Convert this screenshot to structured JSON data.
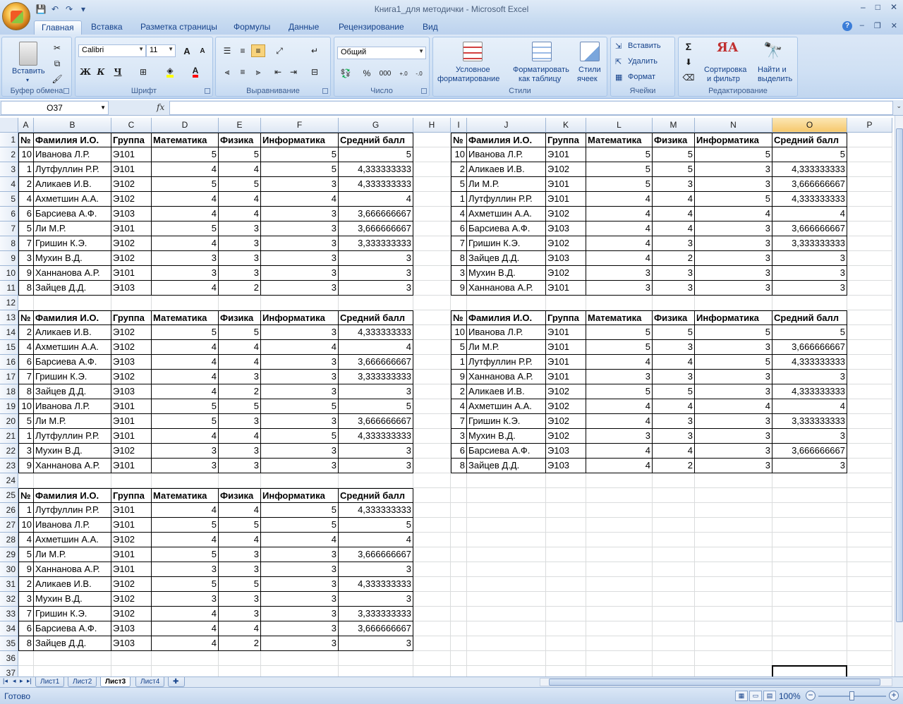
{
  "window": {
    "title": "Книга1_для методички - Microsoft Excel",
    "min": "–",
    "max": "□",
    "close": "✕",
    "wb_min": "–",
    "wb_max": "❐",
    "wb_close": "✕"
  },
  "qat": {
    "save": "💾",
    "undo": "↶",
    "redo": "↷",
    "more": "▾"
  },
  "tabs": [
    "Главная",
    "Вставка",
    "Разметка страницы",
    "Формулы",
    "Данные",
    "Рецензирование",
    "Вид"
  ],
  "active_tab": "Главная",
  "help": "?",
  "ribbon": {
    "clipboard": {
      "label": "Буфер обмена",
      "paste": "Вставить"
    },
    "font": {
      "label": "Шрифт",
      "name": "Calibri",
      "size": "11",
      "bold": "Ж",
      "italic": "К",
      "underline": "Ч",
      "grow": "A",
      "shrink": "A",
      "fill_color": "#ffff00",
      "font_color": "#ff0000"
    },
    "alignment": {
      "label": "Выравнивание"
    },
    "number": {
      "label": "Число",
      "format": "Общий",
      "percent": "%",
      "thousands": "000",
      "inc_dec": ",0 ,00",
      "dec_dec": ",00 ,0"
    },
    "styles": {
      "label": "Стили",
      "cond_format_1": "Условное",
      "cond_format_2": "форматирование",
      "table_1": "Форматировать",
      "table_2": "как таблицу",
      "cell_styles_1": "Стили",
      "cell_styles_2": "ячеек"
    },
    "cells": {
      "label": "Ячейки",
      "insert": "Вставить",
      "delete": "Удалить",
      "format": "Формат"
    },
    "editing": {
      "label": "Редактирование",
      "sum": "Σ",
      "sort_1": "Сортировка",
      "sort_2": "и фильтр",
      "find_1": "Найти и",
      "find_2": "выделить"
    }
  },
  "formula_bar": {
    "name_box": "O37",
    "fx": "fx",
    "formula": ""
  },
  "columns": [
    "A",
    "B",
    "C",
    "D",
    "E",
    "F",
    "G",
    "H",
    "I",
    "J",
    "K",
    "L",
    "M",
    "N",
    "O",
    "P"
  ],
  "selected_column": "O",
  "rows": [
    "1",
    "2",
    "3",
    "4",
    "5",
    "6",
    "7",
    "8",
    "9",
    "10",
    "11",
    "12",
    "13",
    "14",
    "15",
    "16",
    "17",
    "18",
    "19",
    "20",
    "21",
    "22",
    "23",
    "24",
    "25",
    "26",
    "27",
    "28",
    "29",
    "30",
    "31",
    "32",
    "33",
    "34",
    "35",
    "36",
    "37"
  ],
  "headers": [
    "№",
    "Фамилия И.О.",
    "Группа",
    "Математика",
    "Физика",
    "Информатика",
    "Средний балл"
  ],
  "tables": [
    {
      "id": "t1",
      "rows": [
        [
          "10",
          "Иванова Л.Р.",
          "Э101",
          "5",
          "5",
          "5",
          "5"
        ],
        [
          "1",
          "Лутфуллин Р.Р.",
          "Э101",
          "4",
          "4",
          "5",
          "4,333333333"
        ],
        [
          "2",
          "Аликаев И.В.",
          "Э102",
          "5",
          "5",
          "3",
          "4,333333333"
        ],
        [
          "4",
          "Ахметшин А.А.",
          "Э102",
          "4",
          "4",
          "4",
          "4"
        ],
        [
          "6",
          "Барсиева А.Ф.",
          "Э103",
          "4",
          "4",
          "3",
          "3,666666667"
        ],
        [
          "5",
          "Ли М.Р.",
          "Э101",
          "5",
          "3",
          "3",
          "3,666666667"
        ],
        [
          "7",
          "Гришин К.Э.",
          "Э102",
          "4",
          "3",
          "3",
          "3,333333333"
        ],
        [
          "3",
          "Мухин В.Д.",
          "Э102",
          "3",
          "3",
          "3",
          "3"
        ],
        [
          "9",
          "Ханнанова А.Р.",
          "Э101",
          "3",
          "3",
          "3",
          "3"
        ],
        [
          "8",
          "Зайцев Д.Д.",
          "Э103",
          "4",
          "2",
          "3",
          "3"
        ]
      ]
    },
    {
      "id": "t2",
      "rows": [
        [
          "10",
          "Иванова Л.Р.",
          "Э101",
          "5",
          "5",
          "5",
          "5"
        ],
        [
          "2",
          "Аликаев И.В.",
          "Э102",
          "5",
          "5",
          "3",
          "4,333333333"
        ],
        [
          "5",
          "Ли М.Р.",
          "Э101",
          "5",
          "3",
          "3",
          "3,666666667"
        ],
        [
          "1",
          "Лутфуллин Р.Р.",
          "Э101",
          "4",
          "4",
          "5",
          "4,333333333"
        ],
        [
          "4",
          "Ахметшин А.А.",
          "Э102",
          "4",
          "4",
          "4",
          "4"
        ],
        [
          "6",
          "Барсиева А.Ф.",
          "Э103",
          "4",
          "4",
          "3",
          "3,666666667"
        ],
        [
          "7",
          "Гришин К.Э.",
          "Э102",
          "4",
          "3",
          "3",
          "3,333333333"
        ],
        [
          "8",
          "Зайцев Д.Д.",
          "Э103",
          "4",
          "2",
          "3",
          "3"
        ],
        [
          "3",
          "Мухин В.Д.",
          "Э102",
          "3",
          "3",
          "3",
          "3"
        ],
        [
          "9",
          "Ханнанова А.Р.",
          "Э101",
          "3",
          "3",
          "3",
          "3"
        ]
      ]
    },
    {
      "id": "t3",
      "rows": [
        [
          "2",
          "Аликаев И.В.",
          "Э102",
          "5",
          "5",
          "3",
          "4,333333333"
        ],
        [
          "4",
          "Ахметшин А.А.",
          "Э102",
          "4",
          "4",
          "4",
          "4"
        ],
        [
          "6",
          "Барсиева А.Ф.",
          "Э103",
          "4",
          "4",
          "3",
          "3,666666667"
        ],
        [
          "7",
          "Гришин К.Э.",
          "Э102",
          "4",
          "3",
          "3",
          "3,333333333"
        ],
        [
          "8",
          "Зайцев Д.Д.",
          "Э103",
          "4",
          "2",
          "3",
          "3"
        ],
        [
          "10",
          "Иванова Л.Р.",
          "Э101",
          "5",
          "5",
          "5",
          "5"
        ],
        [
          "5",
          "Ли М.Р.",
          "Э101",
          "5",
          "3",
          "3",
          "3,666666667"
        ],
        [
          "1",
          "Лутфуллин Р.Р.",
          "Э101",
          "4",
          "4",
          "5",
          "4,333333333"
        ],
        [
          "3",
          "Мухин В.Д.",
          "Э102",
          "3",
          "3",
          "3",
          "3"
        ],
        [
          "9",
          "Ханнанова А.Р.",
          "Э101",
          "3",
          "3",
          "3",
          "3"
        ]
      ]
    },
    {
      "id": "t4",
      "rows": [
        [
          "10",
          "Иванова Л.Р.",
          "Э101",
          "5",
          "5",
          "5",
          "5"
        ],
        [
          "5",
          "Ли М.Р.",
          "Э101",
          "5",
          "3",
          "3",
          "3,666666667"
        ],
        [
          "1",
          "Лутфуллин Р.Р.",
          "Э101",
          "4",
          "4",
          "5",
          "4,333333333"
        ],
        [
          "9",
          "Ханнанова А.Р.",
          "Э101",
          "3",
          "3",
          "3",
          "3"
        ],
        [
          "2",
          "Аликаев И.В.",
          "Э102",
          "5",
          "5",
          "3",
          "4,333333333"
        ],
        [
          "4",
          "Ахметшин А.А.",
          "Э102",
          "4",
          "4",
          "4",
          "4"
        ],
        [
          "7",
          "Гришин К.Э.",
          "Э102",
          "4",
          "3",
          "3",
          "3,333333333"
        ],
        [
          "3",
          "Мухин В.Д.",
          "Э102",
          "3",
          "3",
          "3",
          "3"
        ],
        [
          "6",
          "Барсиева А.Ф.",
          "Э103",
          "4",
          "4",
          "3",
          "3,666666667"
        ],
        [
          "8",
          "Зайцев Д.Д.",
          "Э103",
          "4",
          "2",
          "3",
          "3"
        ]
      ]
    },
    {
      "id": "t5",
      "rows": [
        [
          "1",
          "Лутфуллин Р.Р.",
          "Э101",
          "4",
          "4",
          "5",
          "4,333333333"
        ],
        [
          "10",
          "Иванова Л.Р.",
          "Э101",
          "5",
          "5",
          "5",
          "5"
        ],
        [
          "4",
          "Ахметшин А.А.",
          "Э102",
          "4",
          "4",
          "4",
          "4"
        ],
        [
          "5",
          "Ли М.Р.",
          "Э101",
          "5",
          "3",
          "3",
          "3,666666667"
        ],
        [
          "9",
          "Ханнанова А.Р.",
          "Э101",
          "3",
          "3",
          "3",
          "3"
        ],
        [
          "2",
          "Аликаев И.В.",
          "Э102",
          "5",
          "5",
          "3",
          "4,333333333"
        ],
        [
          "3",
          "Мухин В.Д.",
          "Э102",
          "3",
          "3",
          "3",
          "3"
        ],
        [
          "7",
          "Гришин К.Э.",
          "Э102",
          "4",
          "3",
          "3",
          "3,333333333"
        ],
        [
          "6",
          "Барсиева А.Ф.",
          "Э103",
          "4",
          "4",
          "3",
          "3,666666667"
        ],
        [
          "8",
          "Зайцев Д.Д.",
          "Э103",
          "4",
          "2",
          "3",
          "3"
        ]
      ]
    }
  ],
  "sheets": [
    "Лист1",
    "Лист2",
    "Лист3",
    "Лист4"
  ],
  "active_sheet": "Лист3",
  "status": {
    "ready": "Готово",
    "zoom": "100%",
    "zoom_level_percent": 100
  }
}
